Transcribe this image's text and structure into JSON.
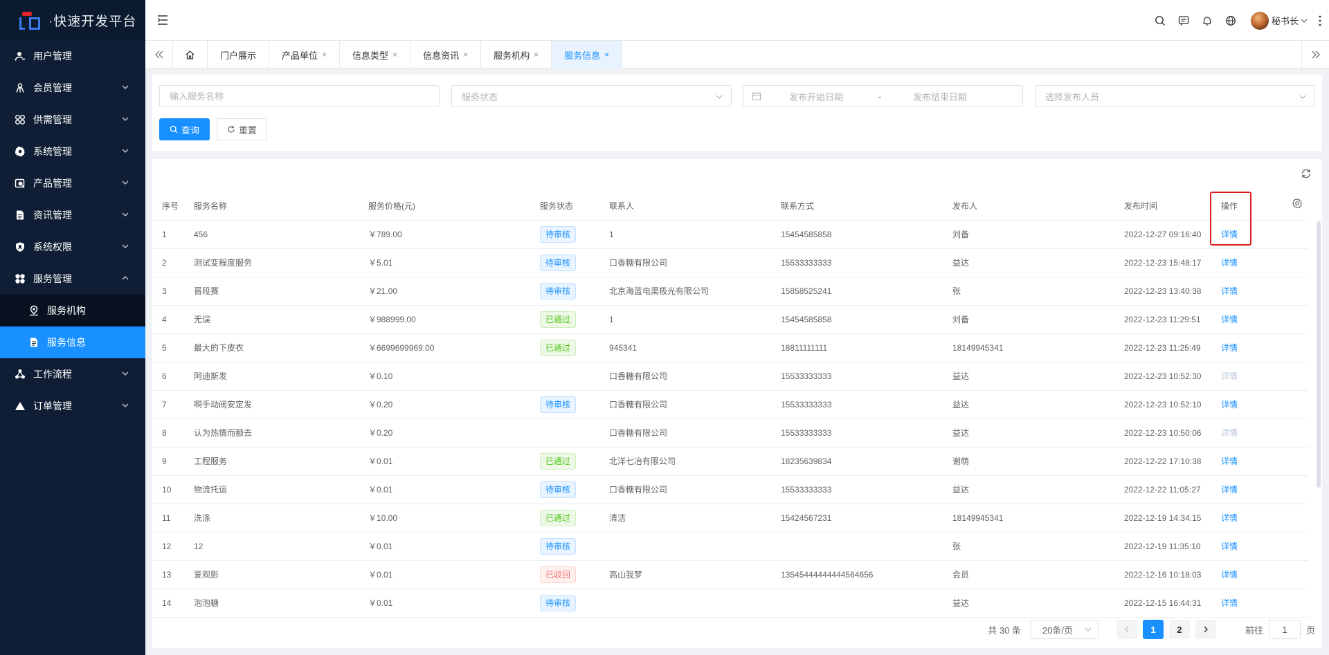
{
  "app": {
    "title": "·快速开发平台"
  },
  "sidebar": {
    "items": [
      {
        "label": "用户管理",
        "icon": "user-icon",
        "expandable": false
      },
      {
        "label": "会员管理",
        "icon": "member-icon",
        "expandable": true
      },
      {
        "label": "供需管理",
        "icon": "supply-demand-icon",
        "expandable": true
      },
      {
        "label": "系统管理",
        "icon": "gear-icon",
        "expandable": true
      },
      {
        "label": "产品管理",
        "icon": "product-icon",
        "expandable": true
      },
      {
        "label": "资讯管理",
        "icon": "document-icon",
        "expandable": true
      },
      {
        "label": "系统权限",
        "icon": "shield-icon",
        "expandable": true
      },
      {
        "label": "服务管理",
        "icon": "service-icon",
        "expandable": true,
        "expanded": true,
        "children": [
          {
            "label": "服务机构",
            "icon": "location-icon"
          },
          {
            "label": "服务信息",
            "icon": "document-icon",
            "active": true
          }
        ]
      },
      {
        "label": "工作流程",
        "icon": "workflow-icon",
        "expandable": true
      },
      {
        "label": "订单管理",
        "icon": "triangle-icon",
        "expandable": true
      }
    ]
  },
  "header": {
    "user_name": "秘书长"
  },
  "tabs": [
    {
      "label": "门户展示",
      "closable": false
    },
    {
      "label": "产品单位",
      "closable": true
    },
    {
      "label": "信息类型",
      "closable": true
    },
    {
      "label": "信息资讯",
      "closable": true
    },
    {
      "label": "服务机构",
      "closable": true
    },
    {
      "label": "服务信息",
      "closable": true,
      "active": true
    }
  ],
  "tab_close_glyph": "×",
  "search": {
    "name_placeholder": "输入服务名称",
    "status_placeholder": "服务状态",
    "start_date_placeholder": "发布开始日期",
    "date_separator": "-",
    "end_date_placeholder": "发布结束日期",
    "publisher_placeholder": "选择发布人员",
    "query_label": "查询",
    "reset_label": "重置"
  },
  "table": {
    "columns": [
      "序号",
      "服务名称",
      "服务价格(元)",
      "服务状态",
      "联系人",
      "联系方式",
      "发布人",
      "发布时间",
      "操作"
    ],
    "action_label": "详情",
    "rows": [
      {
        "idx": "1",
        "name": "456",
        "price": "￥789.00",
        "status": "待审核",
        "status_type": "pending",
        "contact": "1",
        "phone": "15454585858",
        "publisher": "刘备",
        "time": "2022-12-27 09:16:40",
        "action_enabled": true
      },
      {
        "idx": "2",
        "name": "测试变程度服务",
        "price": "￥5.01",
        "status": "待审核",
        "status_type": "pending",
        "contact": "口香糖有限公司",
        "phone": "15533333333",
        "publisher": "益达",
        "time": "2022-12-23 15:48:17",
        "action_enabled": true
      },
      {
        "idx": "3",
        "name": "晋段赛",
        "price": "￥21.00",
        "status": "待审核",
        "status_type": "pending",
        "contact": "北京海蓝电渠极光有限公司",
        "phone": "15858525241",
        "publisher": "张",
        "time": "2022-12-23 13:40:38",
        "action_enabled": true
      },
      {
        "idx": "4",
        "name": "无误",
        "price": "￥988999.00",
        "status": "已通过",
        "status_type": "passed",
        "contact": "1",
        "phone": "15454585858",
        "publisher": "刘备",
        "time": "2022-12-23 11:29:51",
        "action_enabled": true
      },
      {
        "idx": "5",
        "name": "最大的下皮衣",
        "price": "￥6699699969.00",
        "status": "已通过",
        "status_type": "passed",
        "contact": "945341",
        "phone": "18811111111",
        "publisher": "18149945341",
        "time": "2022-12-23 11:25:49",
        "action_enabled": true
      },
      {
        "idx": "6",
        "name": "阿迪斯发",
        "price": "￥0.10",
        "status": "",
        "status_type": "",
        "contact": "口香糖有限公司",
        "phone": "15533333333",
        "publisher": "益达",
        "time": "2022-12-23 10:52:30",
        "action_enabled": false
      },
      {
        "idx": "7",
        "name": "啊手动阀安定发",
        "price": "￥0.20",
        "status": "待审核",
        "status_type": "pending",
        "contact": "口香糖有限公司",
        "phone": "15533333333",
        "publisher": "益达",
        "time": "2022-12-23 10:52:10",
        "action_enabled": true
      },
      {
        "idx": "8",
        "name": "认为热情而额去",
        "price": "￥0.20",
        "status": "",
        "status_type": "",
        "contact": "口香糖有限公司",
        "phone": "15533333333",
        "publisher": "益达",
        "time": "2022-12-23 10:50:06",
        "action_enabled": false
      },
      {
        "idx": "9",
        "name": "工程服务",
        "price": "￥0.01",
        "status": "已通过",
        "status_type": "passed",
        "contact": "北洋七冶有限公司",
        "phone": "18235639834",
        "publisher": "谢萌",
        "time": "2022-12-22 17:10:38",
        "action_enabled": true
      },
      {
        "idx": "10",
        "name": "物流托运",
        "price": "￥0.01",
        "status": "待审核",
        "status_type": "pending",
        "contact": "口香糖有限公司",
        "phone": "15533333333",
        "publisher": "益达",
        "time": "2022-12-22 11:05:27",
        "action_enabled": true
      },
      {
        "idx": "11",
        "name": "洗涤",
        "price": "￥10.00",
        "status": "已通过",
        "status_type": "passed",
        "contact": "清洁",
        "phone": "15424567231",
        "publisher": "18149945341",
        "time": "2022-12-19 14:34:15",
        "action_enabled": true
      },
      {
        "idx": "12",
        "name": "12",
        "price": "￥0.01",
        "status": "待审核",
        "status_type": "pending",
        "contact": "",
        "phone": "",
        "publisher": "张",
        "time": "2022-12-19 11:35:10",
        "action_enabled": true
      },
      {
        "idx": "13",
        "name": "爱观影",
        "price": "￥0.01",
        "status": "已驳回",
        "status_type": "rejected",
        "contact": "高山我梦",
        "phone": "13545444444444564656",
        "publisher": "会员",
        "time": "2022-12-16 10:18:03",
        "action_enabled": true
      },
      {
        "idx": "14",
        "name": "泡泡糖",
        "price": "￥0.01",
        "status": "待审核",
        "status_type": "pending",
        "contact": "",
        "phone": "",
        "publisher": "益达",
        "time": "2022-12-15 16:44:31",
        "action_enabled": true
      }
    ]
  },
  "pagination": {
    "total_text": "共 30 条",
    "page_size_text": "20条/页",
    "pages": [
      "1",
      "2"
    ],
    "current_page": "1",
    "goto_label": "前往",
    "goto_value": "1",
    "goto_suffix": "页"
  },
  "colors": {
    "sidebar_bg": "#0f1e34",
    "accent": "#1890ff",
    "highlight": "#e01b1b"
  }
}
